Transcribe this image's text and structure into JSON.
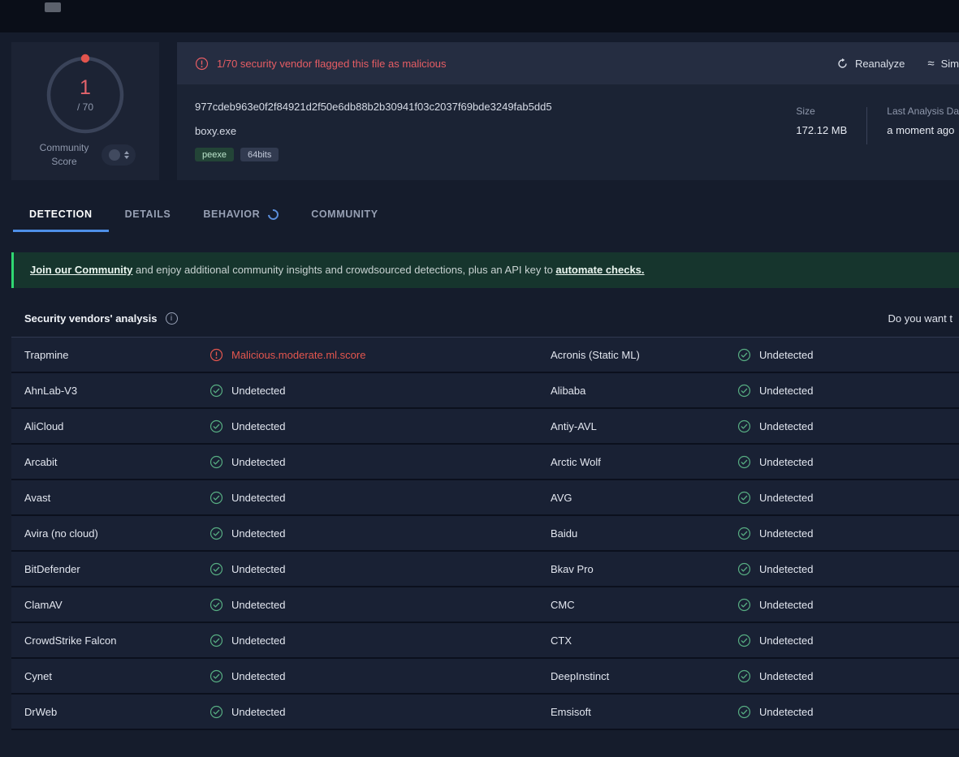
{
  "score": {
    "value": "1",
    "denominator": "/ 70",
    "label": "Community Score"
  },
  "fileHeader": {
    "warning": "1/70 security vendor flagged this file as malicious",
    "reanalyze_label": "Reanalyze",
    "similar_label": "Sim",
    "hash": "977cdeb963e0f2f84921d2f50e6db88b2b30941f03c2037f69bde3249fab5dd5",
    "filename": "boxy.exe",
    "tags": [
      "peexe",
      "64bits"
    ],
    "size_label": "Size",
    "size_value": "172.12 MB",
    "last_analysis_label": "Last Analysis Da",
    "last_analysis_value": "a moment ago"
  },
  "tabs": [
    {
      "label": "DETECTION",
      "active": true
    },
    {
      "label": "DETAILS",
      "active": false
    },
    {
      "label": "BEHAVIOR",
      "active": false,
      "loading": true
    },
    {
      "label": "COMMUNITY",
      "active": false
    }
  ],
  "communityBanner": {
    "link1": "Join our Community",
    "middle": " and enjoy additional community insights and crowdsourced detections, plus an API key to ",
    "link2": "automate checks."
  },
  "analysis": {
    "title": "Security vendors' analysis",
    "right_text": "Do you want t",
    "rows": [
      {
        "l_vendor": "Trapmine",
        "l_result": "Malicious.moderate.ml.score",
        "l_status": "malicious",
        "r_vendor": "Acronis (Static ML)",
        "r_result": "Undetected",
        "r_status": "clean"
      },
      {
        "l_vendor": "AhnLab-V3",
        "l_result": "Undetected",
        "l_status": "clean",
        "r_vendor": "Alibaba",
        "r_result": "Undetected",
        "r_status": "clean"
      },
      {
        "l_vendor": "AliCloud",
        "l_result": "Undetected",
        "l_status": "clean",
        "r_vendor": "Antiy-AVL",
        "r_result": "Undetected",
        "r_status": "clean"
      },
      {
        "l_vendor": "Arcabit",
        "l_result": "Undetected",
        "l_status": "clean",
        "r_vendor": "Arctic Wolf",
        "r_result": "Undetected",
        "r_status": "clean"
      },
      {
        "l_vendor": "Avast",
        "l_result": "Undetected",
        "l_status": "clean",
        "r_vendor": "AVG",
        "r_result": "Undetected",
        "r_status": "clean"
      },
      {
        "l_vendor": "Avira (no cloud)",
        "l_result": "Undetected",
        "l_status": "clean",
        "r_vendor": "Baidu",
        "r_result": "Undetected",
        "r_status": "clean"
      },
      {
        "l_vendor": "BitDefender",
        "l_result": "Undetected",
        "l_status": "clean",
        "r_vendor": "Bkav Pro",
        "r_result": "Undetected",
        "r_status": "clean"
      },
      {
        "l_vendor": "ClamAV",
        "l_result": "Undetected",
        "l_status": "clean",
        "r_vendor": "CMC",
        "r_result": "Undetected",
        "r_status": "clean"
      },
      {
        "l_vendor": "CrowdStrike Falcon",
        "l_result": "Undetected",
        "l_status": "clean",
        "r_vendor": "CTX",
        "r_result": "Undetected",
        "r_status": "clean"
      },
      {
        "l_vendor": "Cynet",
        "l_result": "Undetected",
        "l_status": "clean",
        "r_vendor": "DeepInstinct",
        "r_result": "Undetected",
        "r_status": "clean"
      },
      {
        "l_vendor": "DrWeb",
        "l_result": "Undetected",
        "l_status": "clean",
        "r_vendor": "Emsisoft",
        "r_result": "Undetected",
        "r_status": "clean"
      }
    ]
  },
  "colors": {
    "accent_red": "#e65d64",
    "result_red": "#e4564e",
    "accent_green": "#57ad82",
    "tab_accent": "#4e8fe8",
    "banner_green": "#2fd771"
  }
}
